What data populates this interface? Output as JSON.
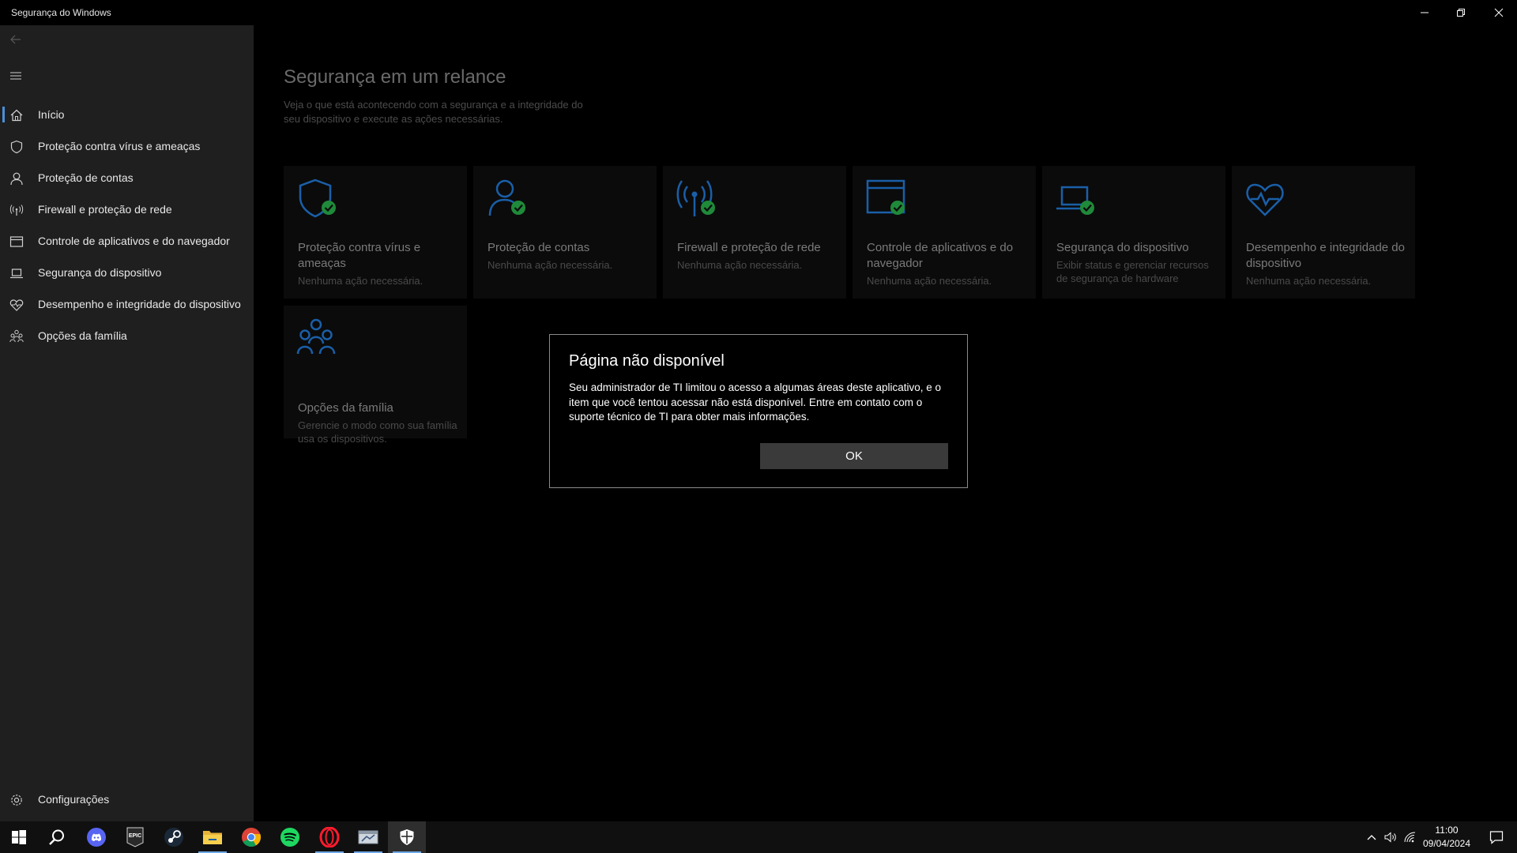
{
  "window": {
    "title": "Segurança do Windows",
    "controls": [
      "minimize-icon",
      "restore-icon",
      "close-icon"
    ]
  },
  "sidebar": {
    "items": [
      {
        "label": "Início",
        "icon": "home-icon",
        "active": true
      },
      {
        "label": "Proteção contra vírus e ameaças",
        "icon": "shield-icon"
      },
      {
        "label": "Proteção de contas",
        "icon": "person-icon"
      },
      {
        "label": "Firewall e proteção de rede",
        "icon": "antenna-icon"
      },
      {
        "label": "Controle de aplicativos e do navegador",
        "icon": "browser-window-icon"
      },
      {
        "label": "Segurança do dispositivo",
        "icon": "laptop-icon"
      },
      {
        "label": "Desempenho e integridade do dispositivo",
        "icon": "heart-icon"
      },
      {
        "label": "Opções da família",
        "icon": "family-icon"
      }
    ],
    "settings_label": "Configurações"
  },
  "main": {
    "title": "Segurança em um relance",
    "subtitle": "Veja o que está acontecendo com a segurança e a integridade do seu dispositivo e execute as ações necessárias.",
    "tiles": [
      {
        "title": "Proteção contra vírus e ameaças",
        "desc": "Nenhuma ação necessária.",
        "icon": "shield-check-icon"
      },
      {
        "title": "Proteção de contas",
        "desc": "Nenhuma ação necessária.",
        "icon": "person-check-icon"
      },
      {
        "title": "Firewall e proteção de rede",
        "desc": "Nenhuma ação necessária.",
        "icon": "antenna-check-icon"
      },
      {
        "title": "Controle de aplicativos e do navegador",
        "desc": "Nenhuma ação necessária.",
        "icon": "browser-check-icon"
      },
      {
        "title": "Segurança do dispositivo",
        "desc": "Exibir status e gerenciar recursos de segurança de hardware",
        "icon": "laptop-check-icon"
      },
      {
        "title": "Desempenho e integridade do dispositivo",
        "desc": "Nenhuma ação necessária.",
        "icon": "heart-pulse-icon"
      },
      {
        "title": "Opções da família",
        "desc": "Gerencie o modo como sua família usa os dispositivos.",
        "icon": "family-icon"
      }
    ]
  },
  "dialog": {
    "title": "Página não disponível",
    "message": "Seu administrador de TI limitou o acesso a algumas áreas deste aplicativo, e o item que você tentou acessar não está disponível. Entre em contato com o suporte técnico de TI para obter mais informações.",
    "ok_label": "OK"
  },
  "taskbar": {
    "apps": [
      "windows-start-icon",
      "search-icon",
      "discord-icon",
      "epic-games-icon",
      "steam-icon",
      "file-explorer-icon",
      "chrome-icon",
      "spotify-icon",
      "opera-icon",
      "app-window-icon",
      "windows-security-icon"
    ],
    "epic_text": "EPIC",
    "time": "11:00",
    "date": "09/04/2024"
  },
  "colors": {
    "accent_blue": "#1a5fa8",
    "check_green": "#1f8a3a",
    "sidebar_bg": "#1f1f1f"
  }
}
